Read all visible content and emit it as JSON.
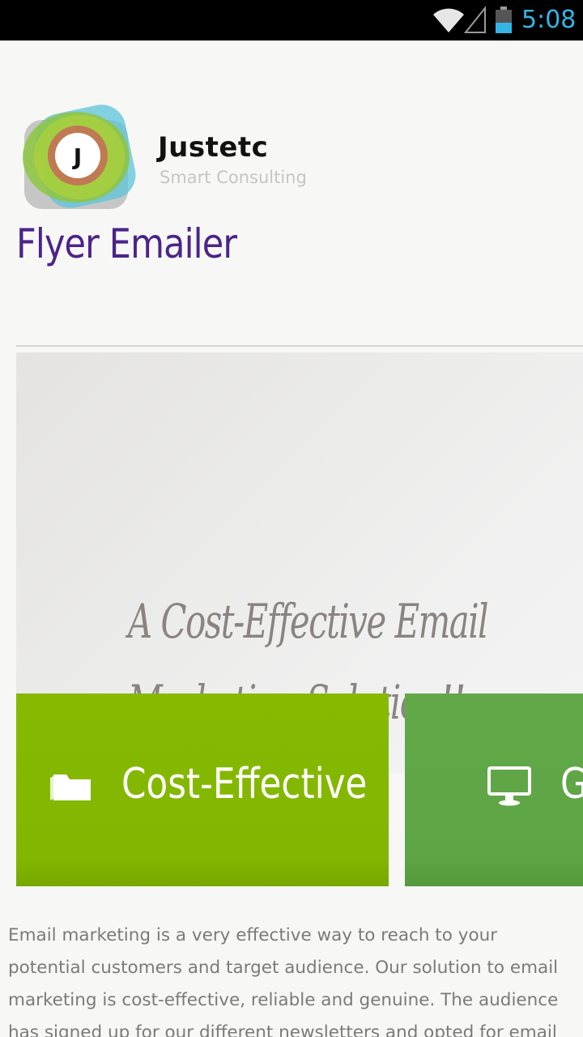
{
  "status_bar": {
    "time": "5:08",
    "icons": [
      "wifi-icon",
      "cell-signal-icon",
      "battery-icon"
    ],
    "time_color": "#33b5e5"
  },
  "brand": {
    "logo_letter": "J",
    "name": "Justetc",
    "tagline": "Smart Consulting"
  },
  "site_title": "Flyer Emailer",
  "hero": {
    "line1": "A Cost-Effective Email",
    "line2": "Marketing Solution!!"
  },
  "tiles": [
    {
      "label": "Cost-Effective",
      "icon": "folder-icon",
      "color": "#82b600"
    },
    {
      "label": "G",
      "icon": "monitor-icon",
      "color": "#5ea545"
    }
  ],
  "body_text": "Email marketing is a very effective way to reach to your potential customers and target audience. Our solution to email marketing is cost-effective, reliable and genuine. The audience has signed up for our different newsletters and opted for email",
  "colors": {
    "title": "#4b2489",
    "body_text": "#7a7a7a"
  }
}
